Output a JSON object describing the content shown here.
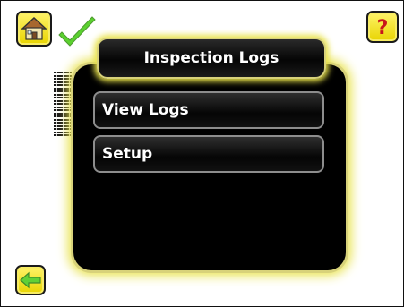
{
  "dialog": {
    "title": "Inspection Logs",
    "menu": [
      {
        "label": "View Logs"
      },
      {
        "label": "Setup"
      }
    ]
  },
  "icons": {
    "home": "home-icon",
    "status": "checkmark-icon",
    "help": "question-mark-icon",
    "back": "back-arrow-icon"
  },
  "colors": {
    "accent_yellow": "#e8e24a",
    "check_green": "#5bd12f",
    "panel_bg": "#000000"
  }
}
